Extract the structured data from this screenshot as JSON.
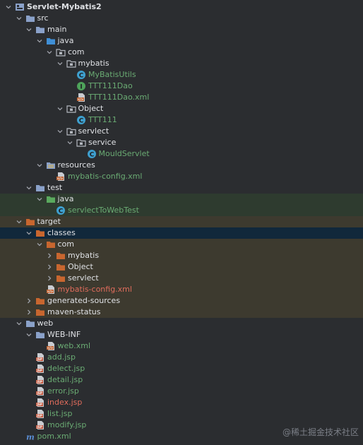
{
  "project": {
    "rows": [
      {
        "label": "Servlet-Mybatis2",
        "depth": 0,
        "arrow": "down",
        "icon": "project-module-icon",
        "color": "default",
        "bold": true,
        "band": ""
      },
      {
        "label": "src",
        "depth": 1,
        "arrow": "down",
        "icon": "folder-icon",
        "color": "default",
        "bold": false,
        "band": ""
      },
      {
        "label": "main",
        "depth": 2,
        "arrow": "down",
        "icon": "folder-icon",
        "color": "default",
        "bold": false,
        "band": ""
      },
      {
        "label": "java",
        "depth": 3,
        "arrow": "down",
        "icon": "source-folder-icon",
        "color": "default",
        "bold": false,
        "band": ""
      },
      {
        "label": "com",
        "depth": 4,
        "arrow": "down",
        "icon": "package-icon",
        "color": "default",
        "bold": false,
        "band": ""
      },
      {
        "label": "mybatis",
        "depth": 5,
        "arrow": "down",
        "icon": "package-icon",
        "color": "default",
        "bold": false,
        "band": ""
      },
      {
        "label": "MyBatisUtils",
        "depth": 6,
        "arrow": "none",
        "icon": "java-class-icon",
        "color": "green",
        "bold": false,
        "band": ""
      },
      {
        "label": "TTT111Dao",
        "depth": 6,
        "arrow": "none",
        "icon": "java-interface-icon",
        "color": "green",
        "bold": false,
        "band": ""
      },
      {
        "label": "TTT111Dao.xml",
        "depth": 6,
        "arrow": "none",
        "icon": "xml-file-icon",
        "color": "green",
        "bold": false,
        "band": ""
      },
      {
        "label": "Object",
        "depth": 5,
        "arrow": "down",
        "icon": "package-icon",
        "color": "default",
        "bold": false,
        "band": ""
      },
      {
        "label": "TTT111",
        "depth": 6,
        "arrow": "none",
        "icon": "java-class-icon",
        "color": "green",
        "bold": false,
        "band": ""
      },
      {
        "label": "servlect",
        "depth": 5,
        "arrow": "down",
        "icon": "package-icon",
        "color": "default",
        "bold": false,
        "band": ""
      },
      {
        "label": "service",
        "depth": 6,
        "arrow": "down",
        "icon": "package-icon",
        "color": "default",
        "bold": false,
        "band": ""
      },
      {
        "label": "MouldServlet",
        "depth": 7,
        "arrow": "none",
        "icon": "java-class-icon",
        "color": "green",
        "bold": false,
        "band": ""
      },
      {
        "label": "resources",
        "depth": 3,
        "arrow": "down",
        "icon": "resources-folder-icon",
        "color": "default",
        "bold": false,
        "band": ""
      },
      {
        "label": "mybatis-config.xml",
        "depth": 4,
        "arrow": "none",
        "icon": "xml-file-icon",
        "color": "green",
        "bold": false,
        "band": ""
      },
      {
        "label": "test",
        "depth": 2,
        "arrow": "down",
        "icon": "folder-icon",
        "color": "default",
        "bold": false,
        "band": ""
      },
      {
        "label": "java",
        "depth": 3,
        "arrow": "down",
        "icon": "test-source-folder-icon",
        "color": "default",
        "bold": false,
        "band": "test"
      },
      {
        "label": "servlectToWebTest",
        "depth": 4,
        "arrow": "none",
        "icon": "java-class-icon",
        "color": "green",
        "bold": false,
        "band": "test"
      },
      {
        "label": "target",
        "depth": 1,
        "arrow": "down",
        "icon": "excluded-folder-icon",
        "color": "default",
        "bold": false,
        "band": "target"
      },
      {
        "label": "classes",
        "depth": 2,
        "arrow": "down",
        "icon": "excluded-folder-icon",
        "color": "default",
        "bold": false,
        "band": "selected"
      },
      {
        "label": "com",
        "depth": 3,
        "arrow": "down",
        "icon": "excluded-folder-icon",
        "color": "default",
        "bold": false,
        "band": "target"
      },
      {
        "label": "mybatis",
        "depth": 4,
        "arrow": "right",
        "icon": "excluded-folder-icon",
        "color": "default",
        "bold": false,
        "band": "target"
      },
      {
        "label": "Object",
        "depth": 4,
        "arrow": "right",
        "icon": "excluded-folder-icon",
        "color": "default",
        "bold": false,
        "band": "target"
      },
      {
        "label": "servlect",
        "depth": 4,
        "arrow": "right",
        "icon": "excluded-folder-icon",
        "color": "default",
        "bold": false,
        "band": "target"
      },
      {
        "label": "mybatis-config.xml",
        "depth": 3,
        "arrow": "none",
        "icon": "xml-file-icon",
        "color": "red",
        "bold": false,
        "band": "target"
      },
      {
        "label": "generated-sources",
        "depth": 2,
        "arrow": "right",
        "icon": "excluded-folder-icon",
        "color": "default",
        "bold": false,
        "band": "target"
      },
      {
        "label": "maven-status",
        "depth": 2,
        "arrow": "right",
        "icon": "excluded-folder-icon",
        "color": "default",
        "bold": false,
        "band": "target"
      },
      {
        "label": "web",
        "depth": 1,
        "arrow": "down",
        "icon": "folder-icon",
        "color": "default",
        "bold": false,
        "band": ""
      },
      {
        "label": "WEB-INF",
        "depth": 2,
        "arrow": "down",
        "icon": "folder-icon",
        "color": "default",
        "bold": false,
        "band": ""
      },
      {
        "label": "web.xml",
        "depth": 3,
        "arrow": "none",
        "icon": "xml-file-icon",
        "color": "green",
        "bold": false,
        "band": ""
      },
      {
        "label": "add.jsp",
        "depth": 2,
        "arrow": "none",
        "icon": "jsp-file-icon",
        "color": "green",
        "bold": false,
        "band": ""
      },
      {
        "label": "delect.jsp",
        "depth": 2,
        "arrow": "none",
        "icon": "jsp-file-icon",
        "color": "green",
        "bold": false,
        "band": ""
      },
      {
        "label": "detail.jsp",
        "depth": 2,
        "arrow": "none",
        "icon": "jsp-file-icon",
        "color": "green",
        "bold": false,
        "band": ""
      },
      {
        "label": "error.jsp",
        "depth": 2,
        "arrow": "none",
        "icon": "jsp-file-icon",
        "color": "green",
        "bold": false,
        "band": ""
      },
      {
        "label": "index.jsp",
        "depth": 2,
        "arrow": "none",
        "icon": "jsp-file-icon",
        "color": "red",
        "bold": false,
        "band": ""
      },
      {
        "label": "list.jsp",
        "depth": 2,
        "arrow": "none",
        "icon": "jsp-file-icon",
        "color": "green",
        "bold": false,
        "band": ""
      },
      {
        "label": "modify.jsp",
        "depth": 2,
        "arrow": "none",
        "icon": "jsp-file-icon",
        "color": "green",
        "bold": false,
        "band": ""
      },
      {
        "label": "pom.xml",
        "depth": 1,
        "arrow": "none",
        "icon": "maven-icon",
        "color": "green",
        "bold": false,
        "band": ""
      }
    ]
  },
  "watermark": {
    "text": "@稀土掘金技术社区"
  },
  "colors": {
    "background": "#2b2d30",
    "selection": "#11283b",
    "test_band": "#2e3b2f",
    "target_band": "#3d3a2f",
    "folder": "#8aa1c9",
    "source_folder": "#3f8fd6",
    "test_folder": "#5aa95e",
    "excluded_folder": "#c8662f",
    "java_class": "#3ea0cf",
    "java_interface": "#4ea35a",
    "xml_file": "#c26a3b",
    "jsp_file": "#c2553b",
    "maven": "#5b8fd6",
    "text_default": "#dfe1e5",
    "text_green": "#6aab73",
    "text_red": "#e06c5c"
  }
}
